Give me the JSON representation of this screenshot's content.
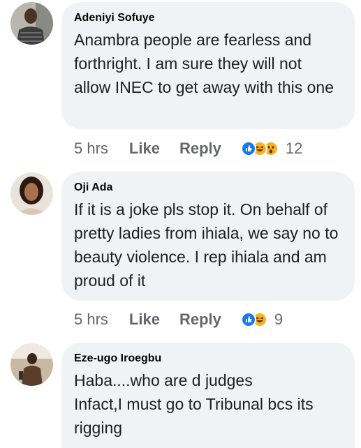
{
  "comments": [
    {
      "author": "Adeniyi Sofuye",
      "text": "Anambra people are fearless and forthright. I am sure they will not allow INEC to get away with this one",
      "time": "5 hrs",
      "like_label": "Like",
      "reply_label": "Reply",
      "reactions": [
        "like-icon",
        "haha-icon",
        "wow-icon"
      ],
      "reaction_count": "12"
    },
    {
      "author": "Oji Ada",
      "text": "If it is a joke pls stop it. On behalf of pretty ladies from ihiala, we say no to beauty violence. I rep ihiala and am proud of it",
      "time": "5 hrs",
      "like_label": "Like",
      "reply_label": "Reply",
      "reactions": [
        "like-icon",
        "haha-icon"
      ],
      "reaction_count": "9"
    },
    {
      "author": "Eze-ugo Iroegbu",
      "text_lines": [
        "Haba....who are d judges",
        "Infact,I must go to Tribunal bcs its rigging"
      ]
    }
  ],
  "colors": {
    "bubble": "#f0f2f5",
    "like_blue": "#1877f2",
    "haha_yellow": "#f7b125",
    "meta_gray": "#65676b"
  }
}
